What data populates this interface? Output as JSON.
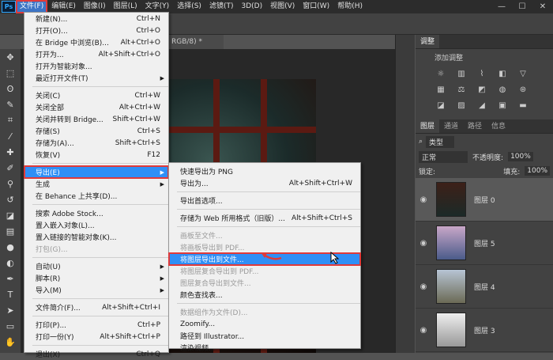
{
  "app": {
    "logo": "Ps"
  },
  "menubar": {
    "items": [
      "文件(F)",
      "编辑(E)",
      "图像(I)",
      "图层(L)",
      "文字(Y)",
      "选择(S)",
      "滤镜(T)",
      "3D(D)",
      "视图(V)",
      "窗口(W)",
      "帮助(H)"
    ],
    "window_buttons": [
      "—",
      "☐",
      "✕"
    ]
  },
  "document_tab": {
    "label": "RGB/8) *"
  },
  "file_menu": {
    "items": [
      {
        "label": "新建(N)...",
        "shortcut": "Ctrl+N"
      },
      {
        "label": "打开(O)...",
        "shortcut": "Ctrl+O"
      },
      {
        "label": "在 Bridge 中浏览(B)...",
        "shortcut": "Alt+Ctrl+O"
      },
      {
        "label": "打开为...",
        "shortcut": "Alt+Shift+Ctrl+O"
      },
      {
        "label": "打开为智能对象...",
        "shortcut": ""
      },
      {
        "label": "最近打开文件(T)",
        "shortcut": ""
      },
      {
        "label": "关闭(C)",
        "shortcut": "Ctrl+W"
      },
      {
        "label": "关闭全部",
        "shortcut": "Alt+Ctrl+W"
      },
      {
        "label": "关闭并转到 Bridge...",
        "shortcut": "Shift+Ctrl+W"
      },
      {
        "label": "存储(S)",
        "shortcut": "Ctrl+S"
      },
      {
        "label": "存储为(A)...",
        "shortcut": "Shift+Ctrl+S"
      },
      {
        "label": "恢复(V)",
        "shortcut": "F12"
      },
      {
        "label": "导出(E)",
        "shortcut": ""
      },
      {
        "label": "生成",
        "shortcut": ""
      },
      {
        "label": "在 Behance 上共享(D)...",
        "shortcut": ""
      },
      {
        "label": "搜索 Adobe Stock...",
        "shortcut": ""
      },
      {
        "label": "置入嵌入对象(L)...",
        "shortcut": ""
      },
      {
        "label": "置入链接的智能对象(K)...",
        "shortcut": ""
      },
      {
        "label": "打包(G)...",
        "shortcut": ""
      },
      {
        "label": "自动(U)",
        "shortcut": ""
      },
      {
        "label": "脚本(R)",
        "shortcut": ""
      },
      {
        "label": "导入(M)",
        "shortcut": ""
      },
      {
        "label": "文件简介(F)...",
        "shortcut": "Alt+Shift+Ctrl+I"
      },
      {
        "label": "打印(P)...",
        "shortcut": "Ctrl+P"
      },
      {
        "label": "打印一份(Y)",
        "shortcut": "Alt+Shift+Ctrl+P"
      },
      {
        "label": "退出(X)",
        "shortcut": "Ctrl+Q"
      }
    ]
  },
  "export_menu": {
    "items": [
      {
        "label": "快速导出为 PNG",
        "shortcut": ""
      },
      {
        "label": "导出为...",
        "shortcut": "Alt+Shift+Ctrl+W"
      },
      {
        "label": "导出首选项...",
        "shortcut": ""
      },
      {
        "label": "存储为 Web 所用格式（旧版）...",
        "shortcut": "Alt+Shift+Ctrl+S"
      },
      {
        "label": "画板至文件...",
        "shortcut": ""
      },
      {
        "label": "将画板导出到 PDF...",
        "shortcut": ""
      },
      {
        "label": "将图层导出到文件...",
        "shortcut": ""
      },
      {
        "label": "将图层复合导出到 PDF...",
        "shortcut": ""
      },
      {
        "label": "图层复合导出到文件...",
        "shortcut": ""
      },
      {
        "label": "颜色查找表...",
        "shortcut": ""
      },
      {
        "label": "数据组作为文件(D)...",
        "shortcut": ""
      },
      {
        "label": "Zoomify...",
        "shortcut": ""
      },
      {
        "label": "路径到 Illustrator...",
        "shortcut": ""
      },
      {
        "label": "渲染视频...",
        "shortcut": ""
      }
    ]
  },
  "panels": {
    "top_tabs": [
      "调整"
    ],
    "adjust_title": "添加调整",
    "layer_tabs": [
      "图层",
      "通道",
      "路径",
      "信息"
    ],
    "kind_label": "类型",
    "blend_mode": "正常",
    "opacity_label": "不透明度:",
    "opacity_value": "100%",
    "lock_label": "锁定:",
    "fill_label": "填充:",
    "fill_value": "100%",
    "layers": [
      "图层 0",
      "图层 5",
      "图层 4",
      "图层 3"
    ]
  },
  "colors": {
    "accent": "#2f8ff6",
    "highlight_box": "#e03a3a"
  }
}
